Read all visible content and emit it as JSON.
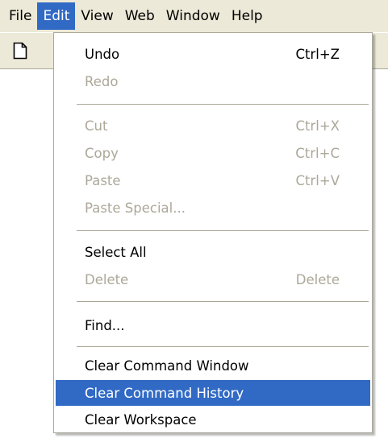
{
  "menubar": {
    "items": [
      {
        "label": "File"
      },
      {
        "label": "Edit",
        "active": true
      },
      {
        "label": "View"
      },
      {
        "label": "Web"
      },
      {
        "label": "Window"
      },
      {
        "label": "Help"
      }
    ]
  },
  "toolbar": {
    "new_file_icon": "new-file-icon"
  },
  "edit_menu": {
    "items": [
      {
        "label": "Undo",
        "shortcut": "Ctrl+Z",
        "enabled": true
      },
      {
        "label": "Redo",
        "shortcut": "",
        "enabled": false
      },
      {
        "label": "Cut",
        "shortcut": "Ctrl+X",
        "enabled": false
      },
      {
        "label": "Copy",
        "shortcut": "Ctrl+C",
        "enabled": false
      },
      {
        "label": "Paste",
        "shortcut": "Ctrl+V",
        "enabled": false
      },
      {
        "label": "Paste Special...",
        "shortcut": "",
        "enabled": false
      },
      {
        "label": "Select All",
        "shortcut": "",
        "enabled": true
      },
      {
        "label": "Delete",
        "shortcut": "Delete",
        "enabled": false
      },
      {
        "label": "Find...",
        "shortcut": "",
        "enabled": true
      },
      {
        "label": "Clear Command Window",
        "shortcut": "",
        "enabled": true
      },
      {
        "label": "Clear Command History",
        "shortcut": "",
        "enabled": true,
        "highlighted": true
      },
      {
        "label": "Clear Workspace",
        "shortcut": "",
        "enabled": true
      }
    ]
  },
  "colors": {
    "menubar_bg": "#ece9d8",
    "highlight": "#316ac5",
    "disabled_text": "#aca899"
  }
}
